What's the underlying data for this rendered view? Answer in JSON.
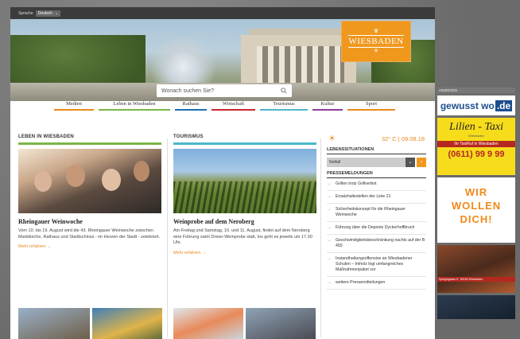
{
  "topbar": {
    "label": "Sprache",
    "language": "Deutsch"
  },
  "logo": {
    "name": "WIESBADEN"
  },
  "search": {
    "placeholder": "Wonach suchen Sie?"
  },
  "nav": [
    {
      "label": "Medien",
      "color": "#e8891b"
    },
    {
      "label": "Leben in Wiesbaden",
      "color": "#7ab648"
    },
    {
      "label": "Rathaus",
      "color": "#1b6fb5"
    },
    {
      "label": "Wirtschaft",
      "color": "#c9262e"
    },
    {
      "label": "Tourismus",
      "color": "#4ab8c9"
    },
    {
      "label": "Kultur",
      "color": "#8a3f98"
    },
    {
      "label": "Sport",
      "color": "#e8891b"
    }
  ],
  "columns": [
    {
      "header": "LEBEN IN WIESBADEN",
      "color": "#7ab648",
      "title": "Rheingauer Weinwoche",
      "text": "Vom 10. bis 19. August wird die 43. Rheingauer Weinwoche zwischen Marktkirche, Rathaus und Stadtschloss - im Herzen der Stadt - zelebriert.",
      "more": "Mehr erfahren"
    },
    {
      "header": "TOURISMUS",
      "color": "#4ab8c9",
      "title": "Weinprobe auf dem Neroberg",
      "text": "Am Freitag und Samstag, 10. und 11. August, findet auf dem Neroberg eine Führung samt Dreier-Weinprobe statt, los geht es jeweils um 17.30 Uhr.",
      "more": "Mehr erfahren"
    }
  ],
  "sidebar": {
    "weather": "32° C | 09.08.18",
    "lebenslagen_title": "LEBENSSITUATIONEN",
    "dropdown_value": "Notfall",
    "press_title": "PRESSEMELDUNGEN",
    "press": [
      "Grillen trotz Grillverbot",
      "Ersatzhaltestellen der Linie 21",
      "Sicherheitskonzept für die Rheingauer Weinwoche",
      "Führung über die Deponie Dyckerhoffbruch",
      "Geschwindigkeitsbeschränkung nachts auf der B 455",
      "Instandhaltungsoffensive an Wiesbadener Schulen – Imholz legt umfangreiches Maßnahmenpaket vor",
      "weitere Pressemitteilungen"
    ]
  },
  "ads": {
    "label": "ANZEIGEN",
    "gewusstwo": "gewusst wo",
    "gewusstwo_tld": ".de",
    "taxi_brand": "Lilien - Taxi",
    "taxi_sub": "Wiesbaden",
    "taxi_line": "Ihr TaxiRuf in Wiesbaden",
    "taxi_phone": "(0611) 99 9 99",
    "wir_lines": [
      "WIR",
      "WOLLEN",
      "DICH!"
    ],
    "photo_strip": "Spiegelgasse 5 · 65183 Wiesbaden"
  }
}
